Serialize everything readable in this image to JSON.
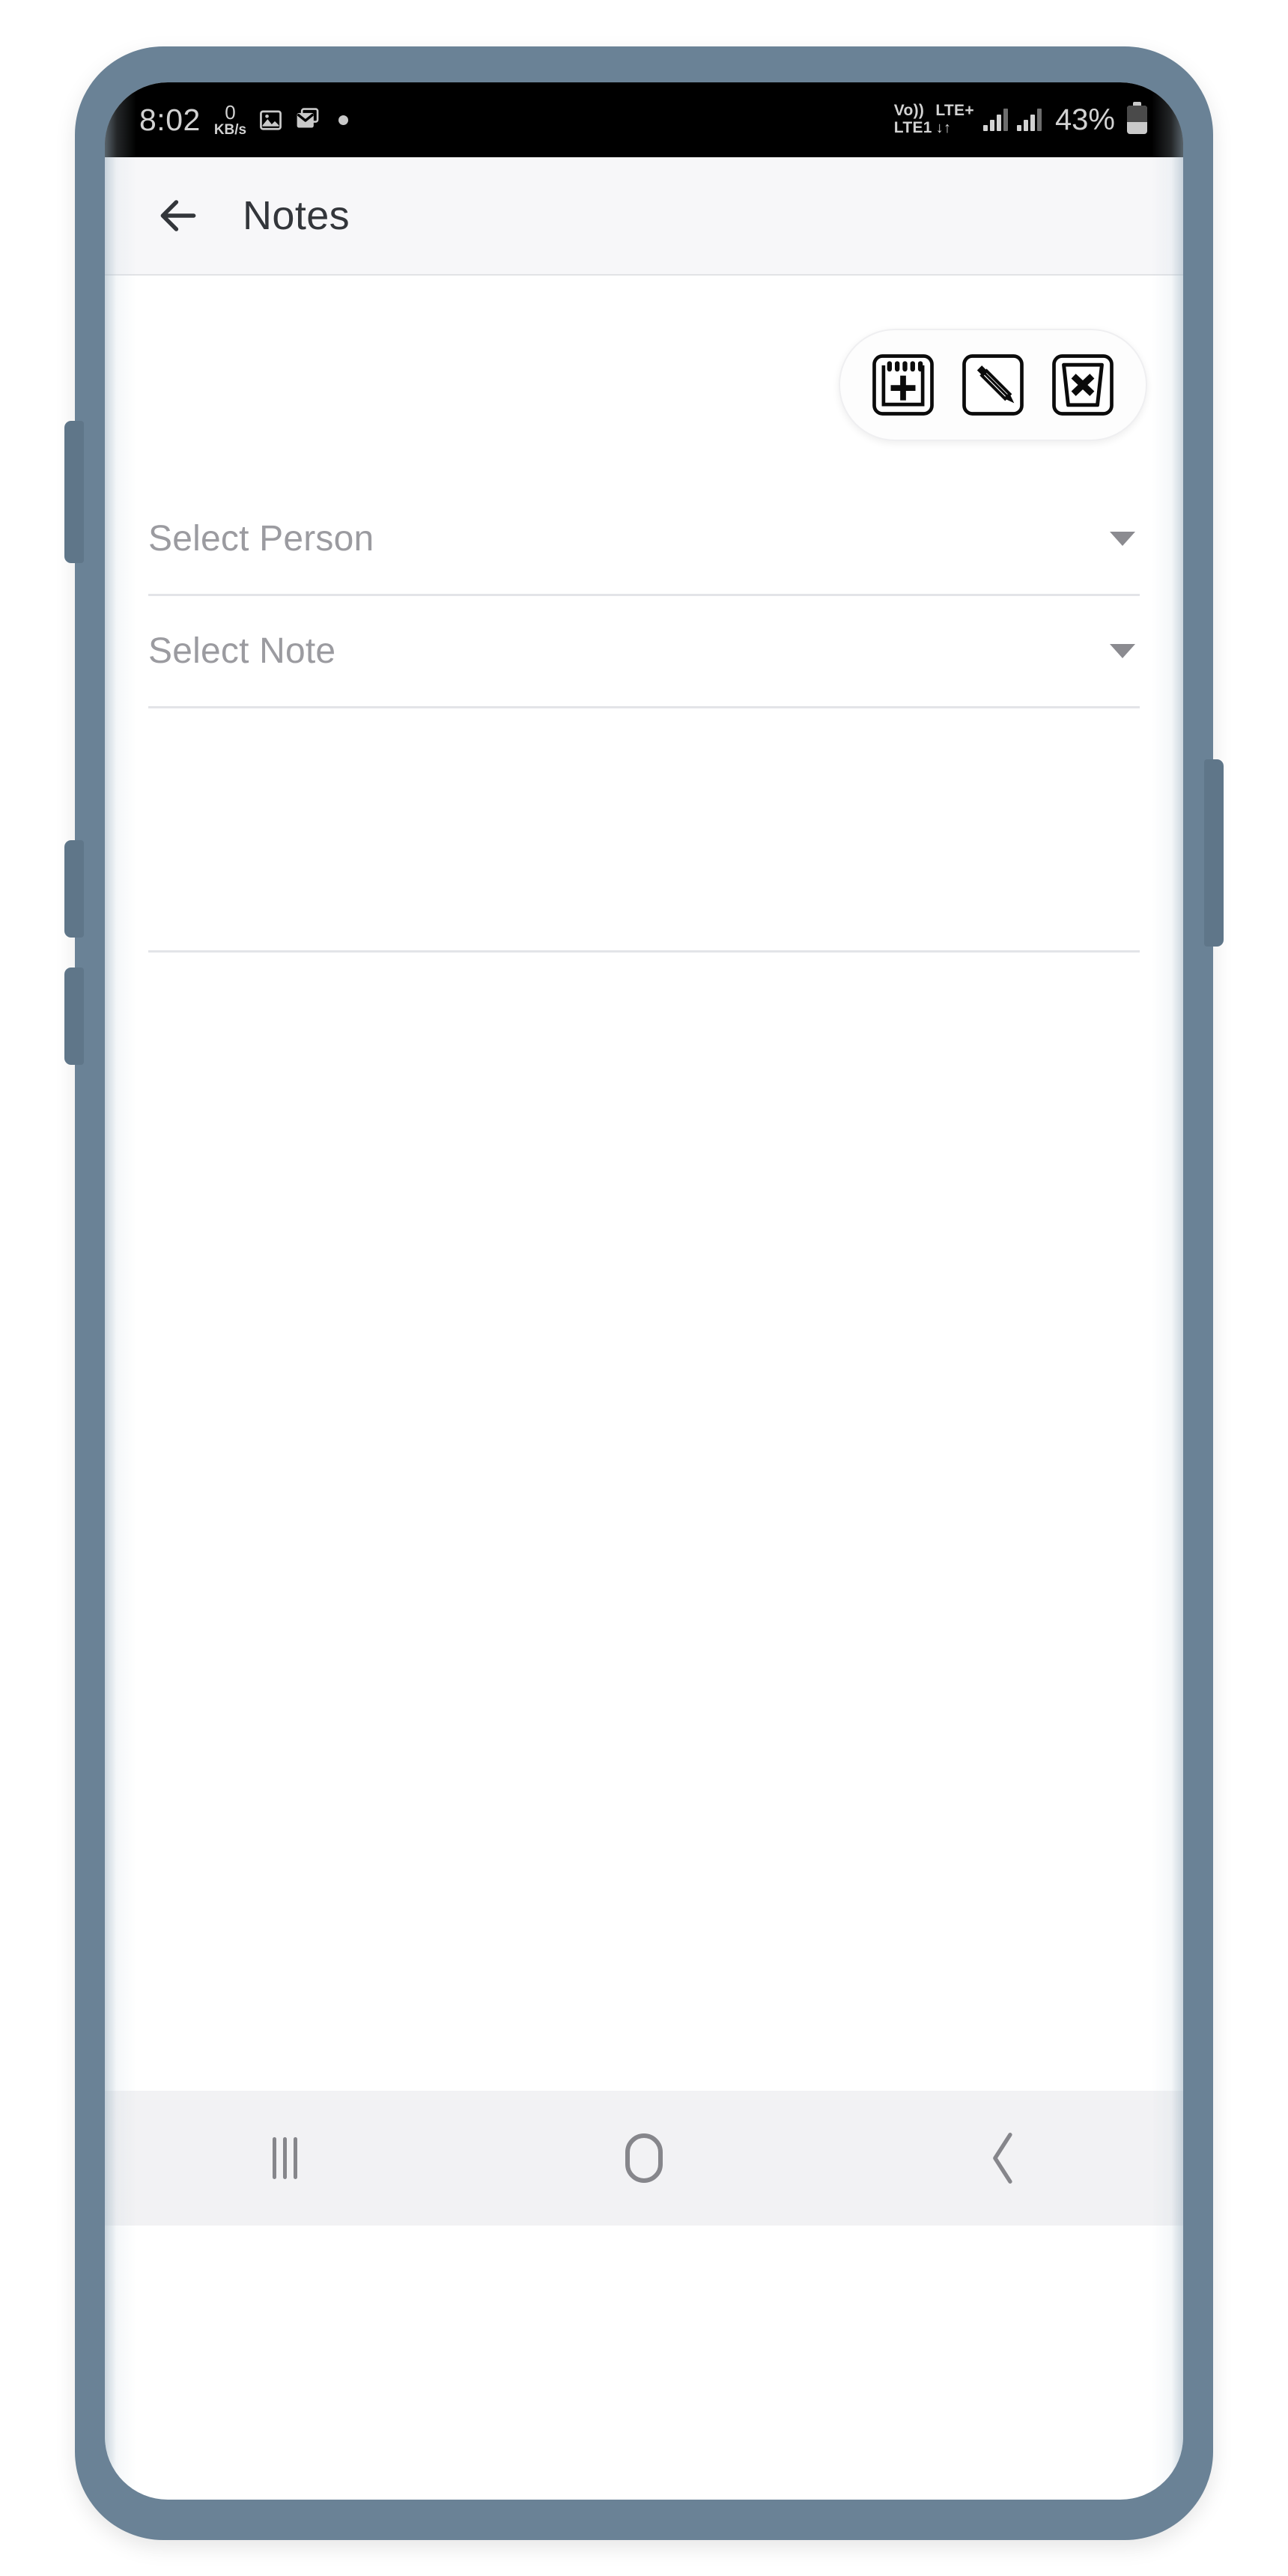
{
  "status_bar": {
    "clock": "8:02",
    "network_speed_value": "0",
    "network_speed_unit": "KB/s",
    "icons": [
      "image-icon",
      "gmail-icon",
      "notification-dot"
    ],
    "volte_line1": "Vo))",
    "volte_line2": "LTE1",
    "network_type": "LTE+",
    "data_arrows": "↓↑",
    "signal_groups": 2,
    "battery_percent": "43%",
    "battery_level": 43
  },
  "app_bar": {
    "back_icon": "arrow-left-icon",
    "title": "Notes"
  },
  "actions": [
    {
      "name": "add-note",
      "icon": "notepad-plus-icon"
    },
    {
      "name": "edit-note",
      "icon": "pencil-icon"
    },
    {
      "name": "delete-note",
      "icon": "trash-x-icon"
    }
  ],
  "form": {
    "person_dropdown": {
      "label": "Select Person",
      "value": "",
      "placeholder": "Select Person",
      "caret_icon": "caret-down-icon"
    },
    "note_dropdown": {
      "label": "Select Note",
      "value": "",
      "placeholder": "Select Note",
      "caret_icon": "caret-down-icon"
    },
    "note_body": {
      "value": "",
      "placeholder": ""
    }
  },
  "nav_bar": {
    "recents_label": "recents-icon",
    "home_label": "home-icon",
    "back_label": "back-chevron-icon"
  },
  "colors": {
    "frame": "#6a8296",
    "status_bar_bg": "#000000",
    "app_bar_bg": "#f7f7f9",
    "screen_bg": "#ffffff",
    "nav_bar_bg": "#f2f2f4",
    "placeholder_text": "#9b9ba0",
    "title_text": "#33363b",
    "divider": "#e3e4e8"
  }
}
